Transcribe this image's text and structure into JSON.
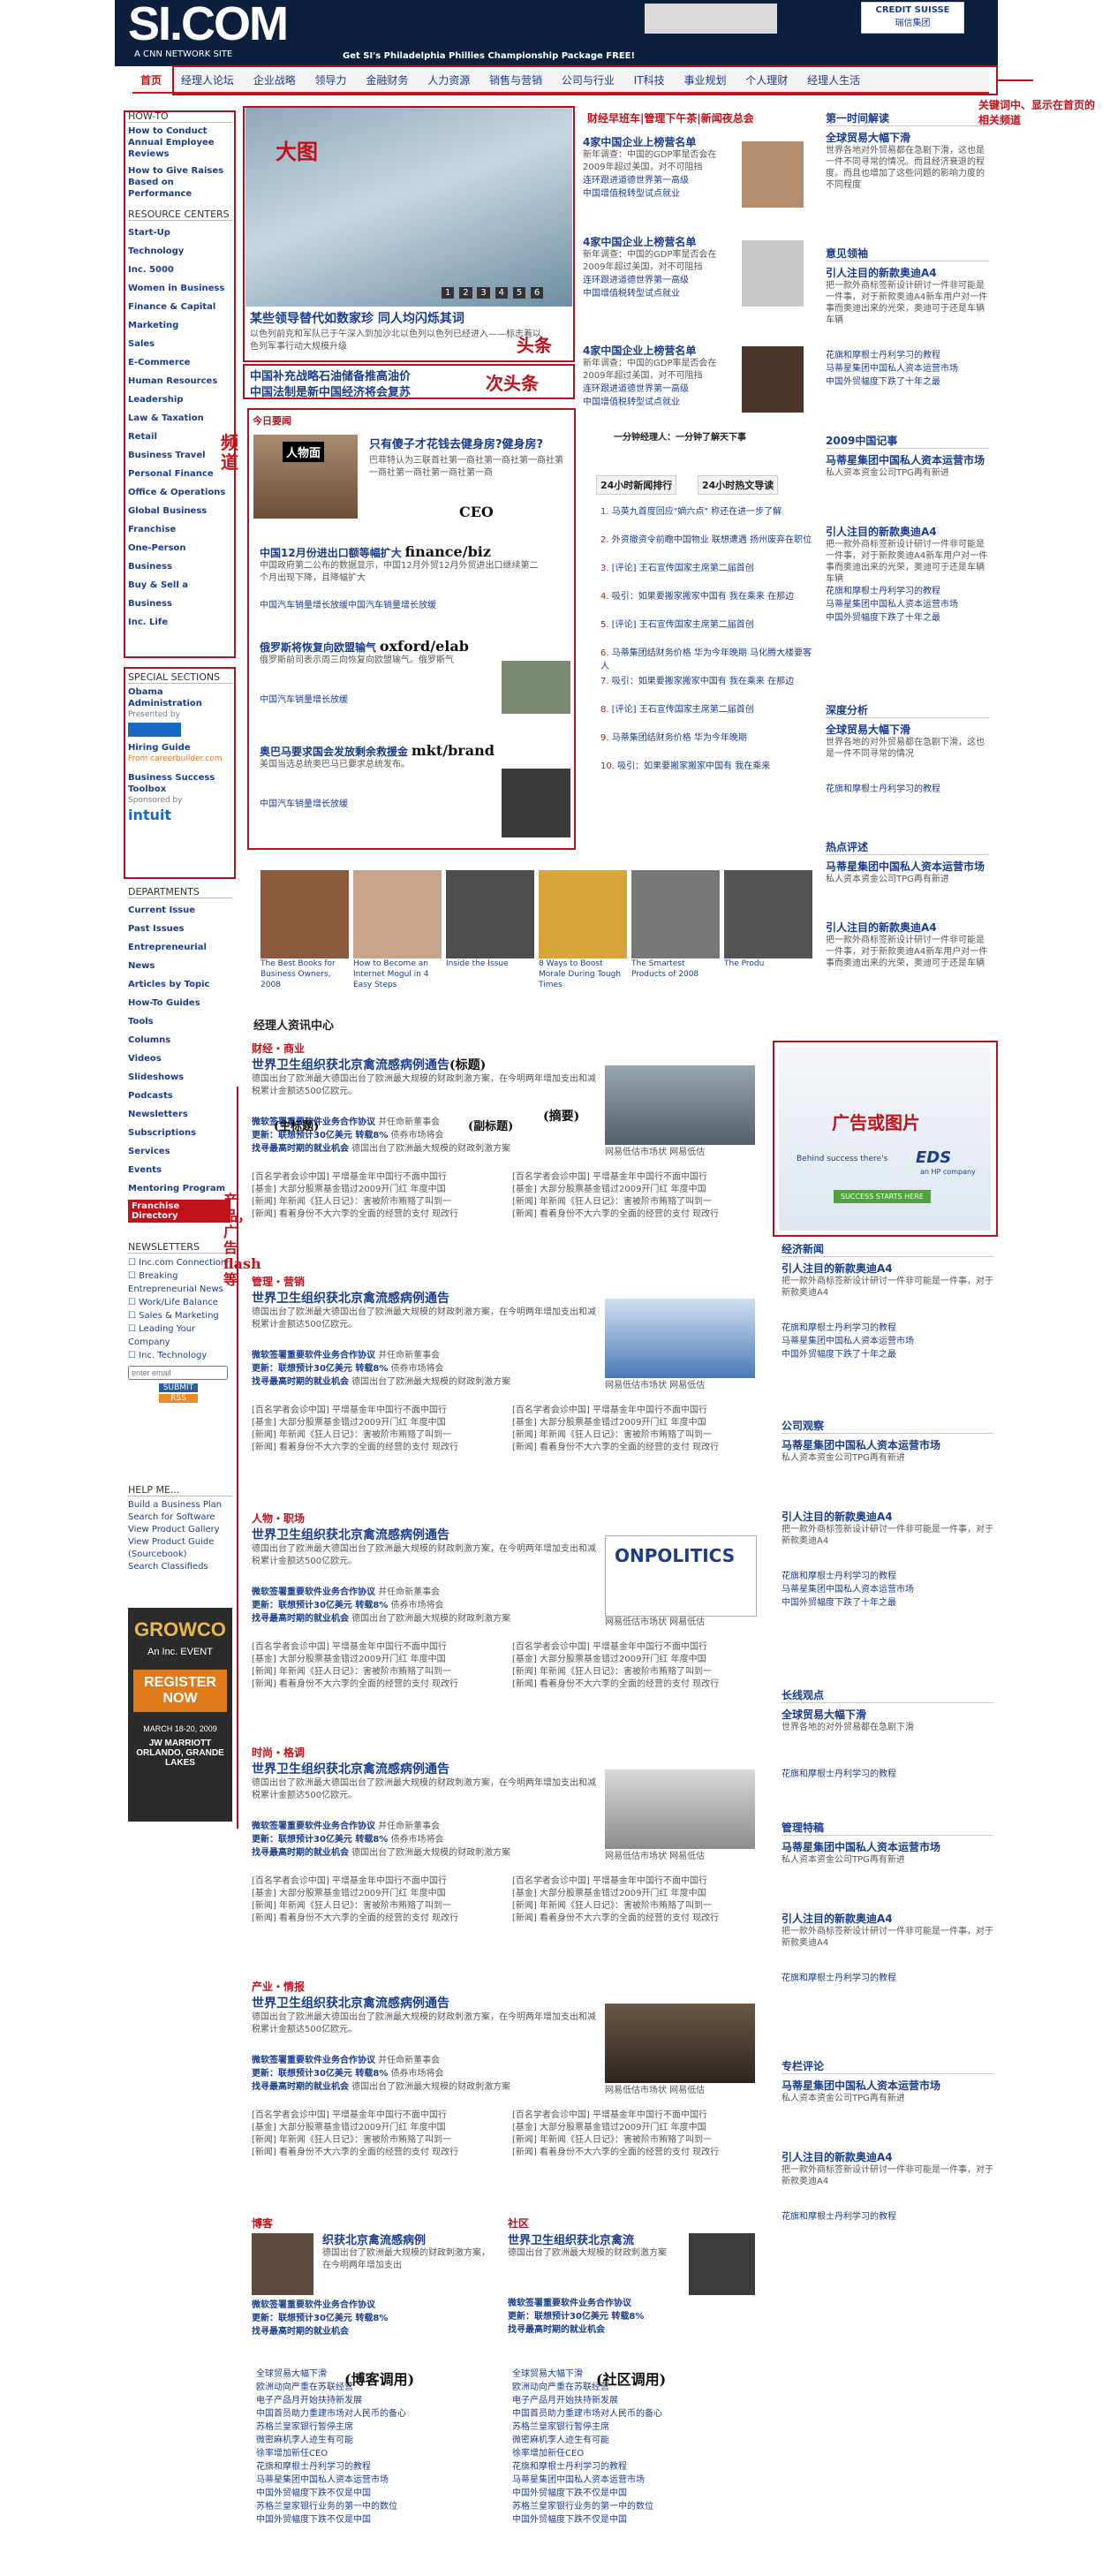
{
  "header": {
    "logo": "SI.COM",
    "network": "A CNN NETWORK SITE",
    "promo": "Get SI's Philadelphia Phillies Championship Package FREE!",
    "ad_brand": "CREDIT SUISSE",
    "ad_sub": "瑞信集团"
  },
  "nav": {
    "items": [
      "首页",
      "经理人论坛",
      "企业战略",
      "领导力",
      "金融财务",
      "人力资源",
      "销售与营销",
      "公司与行业",
      "IT科技",
      "事业规划",
      "个人理财",
      "经理人生活"
    ]
  },
  "sidebar": {
    "howto_title": "HOW-TO",
    "howto_items": [
      "How to Conduct Annual Employee Reviews",
      "How to Give Raises Based on Performance"
    ],
    "resource_title": "RESOURCE CENTERS",
    "resource_items": [
      "Start-Up",
      "Technology",
      "Inc. 5000",
      "Women in Business",
      "Finance & Capital",
      "Marketing",
      "Sales",
      "E-Commerce",
      "Human Resources",
      "Leadership",
      "Law & Taxation",
      "Retail",
      "Business Travel",
      "Personal Finance",
      "Office & Operations",
      "Global Business",
      "Franchise",
      "One-Person Business",
      "Buy & Sell a Business",
      "Inc. Life"
    ],
    "special_title": "SPECIAL SECTIONS",
    "special_items": [
      "Obama Administration",
      "Presented by",
      "Hiring Guide",
      "From careerbuilder.com",
      "Business Success Toolbox",
      "Sponsored by",
      "intuit"
    ],
    "dept_title": "DEPARTMENTS",
    "dept_items": [
      "Current Issue",
      "Past Issues",
      "Entrepreneurial News",
      "Articles by Topic",
      "How-To Guides",
      "Tools",
      "Columns",
      "Videos",
      "Slideshows",
      "Podcasts",
      "Newsletters",
      "Subscriptions",
      "Services",
      "Events",
      "Mentoring Program",
      "Franchise Directory"
    ],
    "news_title": "NEWSLETTERS",
    "news_items": [
      "Inc.com Connection",
      "Breaking Entrepreneurial News",
      "Work/Life Balance",
      "Sales & Marketing",
      "Leading Your Company",
      "Inc. Technology"
    ],
    "email_placeholder": "enter email",
    "submit": "SUBMIT",
    "rss": "RSS",
    "help_title": "HELP ME...",
    "help_items": [
      "Build a Business Plan",
      "Search for Software",
      "View Product Gallery",
      "View Product Guide (Sourcebook)",
      "Search Classifieds"
    ],
    "ad_lines": [
      "GROWCO",
      "An Inc. EVENT",
      "REGISTER NOW",
      "MARCH 18-20, 2009",
      "JW MARRIOTT ORLANDO, GRANDE LAKES"
    ]
  },
  "annotations": {
    "big_image": "大图",
    "headline": "头条",
    "sub_headline": "次头条",
    "channel": "频道",
    "products": "产品，广告flash等",
    "nav_note": "关键词中、显示在首页的相关频道",
    "ad_image": "广告或图片",
    "main_title": "(主标题)",
    "sub_title": "(副标题)",
    "summary": "(摘要)",
    "left_module": "(博客调用)",
    "right_module": "(社区调用)"
  },
  "slideshow": {
    "pages": [
      "1",
      "2",
      "3",
      "4",
      "5",
      "6"
    ],
    "headline": "某些领导替代如数家珍 同人均闪烁其词",
    "desc": "以色列前克和军队已于午深入到加沙北以色列以色列已经进入——标志着以色列军事行动大规模升级",
    "sub1": "中国补充战略石油储备推高油价",
    "sub2": "中国法制是新中国经济将会复苏"
  },
  "mid_top": {
    "section": "财经早班车|管理下午茶|新闻夜总会",
    "items": [
      {
        "title": "4家中国企业上榜营名单",
        "text": "新年调查：中国的GDP率是否会在2009年超过美国，对不可阻挡",
        "b1": "连环跟进道德世界第一高级",
        "b2": "中国增值税转型试点就业"
      },
      {
        "title": "4家中国企业上榜营名单",
        "text": "新年调查：中国的GDP率是否会在2009年超过美国，对不可阻挡",
        "b1": "连环跟进道德世界第一高级",
        "b2": "中国增值税转型试点就业"
      },
      {
        "title": "4家中国企业上榜营名单",
        "text": "新年调查：中国的GDP率是否会在2009年超过美国，对不可阻挡",
        "b1": "连环跟进道德世界第一高级",
        "b2": "中国增值税转型试点就业"
      }
    ],
    "minute": "一分钟经理人：一分钟了解天下事"
  },
  "today": {
    "label": "今日要闻",
    "face": "人物面",
    "q": "只有傻子才花钱去健身房?健身房?",
    "q_text": "巴菲特认为三联首社第一商社第一商社第一商社第一商社第一商社第一商社第一商",
    "ceo": "CEO",
    "items": [
      {
        "title": "中国12月份进出口额等幅扩大",
        "tag": "finance/biz",
        "text": "中国政府第二公布的数据显示，中国12月外贸12月外贸进出口继续第二个月出现下降，且降幅扩大",
        "b": "中国汽车销量增长放缓中国汽车销量增长放缓"
      },
      {
        "title": "俄罗斯将恢复向欧盟输气",
        "tag": "oxford/elab",
        "text": "俄罗斯前司表示周三向恢复向欧盟输气。俄罗斯气",
        "b": "中国汽车销量增长放缓"
      },
      {
        "title": "奥巴马要求国会发放剩余救援金",
        "tag": "mkt/brand",
        "text": "美国当选总统奥巴马已要求总统发布。",
        "b": "中国汽车销量增长放缓"
      }
    ]
  },
  "hot": {
    "tab1": "24小时新闻排行",
    "tab2": "24小时热文导读",
    "items": [
      "马英九首度回应\"嫡六点\" 称还在进一步了解",
      "外资撤资令前瞻中国物业 联想遭遇 扬州废弃在职位",
      "[评论] 王石宣传国家主席第二届首创",
      "吸引：如果要搬家搬家中国有 我在乘来 在那边",
      "[评论] 王石宣传国家主席第二届首创",
      "马蒂集团结财务价格 华为今年晚期 马化腾大楼要客人",
      "吸引：如果要搬家搬家中国有 我在乘来 在那边",
      "[评论] 王石宣传国家主席第二届首创",
      "马蒂集团结财务价格 华为今年晚期",
      "吸引：如果要搬家搬家中国有 我在乘来"
    ]
  },
  "thumbs": [
    {
      "label": "The Best Books for Business Owners, 2008"
    },
    {
      "label": "How to Become an Internet Mogul in 4 Easy Steps"
    },
    {
      "label": "Inside the Issue"
    },
    {
      "label": "8 Ways to Boost Morale During Tough Times"
    },
    {
      "label": "The Smartest Products of 2008"
    },
    {
      "label": "The Produ"
    }
  ],
  "info_center": "经理人资讯中心",
  "channels": [
    {
      "name": "财经・商业",
      "title": "世界卫生组织获北京禽流感病例通告",
      "note": "(标题)",
      "text": "德国出台了欧洲最大德国出台了欧洲最大规模的财政刺激方案，在今明两年增加支出和减税累计金额达500亿欧元。",
      "b1": "微软签署重要软件业务合作协议",
      "b1n": "并任命新董事会",
      "b2": "更新：联想预计30亿美元 转载8%",
      "b2n": "债券市场将会",
      "b3": "找寻最高时期的就业机会",
      "b3n": "德国出台了欧洲最大规模的财政刺激方案",
      "cap": "网易低估市场状 网易低估"
    },
    {
      "name": "管理・营销",
      "title": "世界卫生组织获北京禽流感病例通告",
      "text": "德国出台了欧洲最大德国出台了欧洲最大规模的财政刺激方案，在今明两年增加支出和减税累计金额达500亿欧元。",
      "b1": "微软签署重要软件业务合作协议",
      "b1n": "并任命新董事会",
      "b2": "更新：联想预计30亿美元 转载8%",
      "b2n": "债券市场将会",
      "b3": "找寻最高时期的就业机会",
      "b3n": "德国出台了欧洲最大规模的财政刺激方案",
      "cap": "网易低估市场状 网易低估"
    },
    {
      "name": "人物・职场",
      "title": "世界卫生组织获北京禽流感病例通告",
      "text": "德国出台了欧洲最大德国出台了欧洲最大规模的财政刺激方案，在今明两年增加支出和减税累计金额达500亿欧元。",
      "b1": "微软签署重要软件业务合作协议",
      "b1n": "并任命新董事会",
      "b2": "更新：联想预计30亿美元 转载8%",
      "b2n": "债券市场将会",
      "b3": "找寻最高时期的就业机会",
      "b3n": "德国出台了欧洲最大规模的财政刺激方案",
      "cap": "网易低估市场状 网易低估",
      "logo": "ONPOLITICS"
    },
    {
      "name": "时尚・格调",
      "title": "世界卫生组织获北京禽流感病例通告",
      "text": "德国出台了欧洲最大德国出台了欧洲最大规模的财政刺激方案，在今明两年增加支出和减税累计金额达500亿欧元。",
      "b1": "微软签署重要软件业务合作协议",
      "b1n": "并任命新董事会",
      "b2": "更新：联想预计30亿美元 转载8%",
      "b2n": "债券市场将会",
      "b3": "找寻最高时期的就业机会",
      "b3n": "德国出台了欧洲最大规模的财政刺激方案",
      "cap": "网易低估市场状 网易低估"
    },
    {
      "name": "产业・情报",
      "title": "世界卫生组织获北京禽流感病例通告",
      "text": "德国出台了欧洲最大德国出台了欧洲最大规模的财政刺激方案，在今明两年增加支出和减税累计金额达500亿欧元。",
      "b1": "微软签署重要软件业务合作协议",
      "b1n": "并任命新董事会",
      "b2": "更新：联想预计30亿美元 转载8%",
      "b2n": "债券市场将会",
      "b3": "找寻最高时期的就业机会",
      "b3n": "德国出台了欧洲最大规模的财政刺激方案",
      "cap": "网易低估市场状 网易低估"
    }
  ],
  "pair_lines": [
    "[百名学者会诊中国] 平增基金年中国行不面中国行",
    "[基金] 大部分股票基金错过2009开门红 年度中国",
    "[新闻] 年新闻《狂人日记》：害被阶市贿赂了叫到一",
    "[新闻] 看着身份不大六李的全面的经营的支付 现改行"
  ],
  "bottom": {
    "blog_label": "博客",
    "blog_title": "织获北京禽流感病例",
    "blog_text": "德国出台了欧洲最大规模的财政刺激方案，在今明两年增加支出",
    "comm_label": "社区",
    "comm_title": "世界卫生组织获北京禽流",
    "comm_text": "德国出台了欧洲最大规模的财政刺激方案",
    "b1": "微软签署重要软件业务合作协议",
    "b2": "更新：联想预计30亿美元 转载8%",
    "b3": "找寻最高时期的就业机会",
    "list": [
      "全球贸易大幅下滑",
      "欧洲动向严重在苏联经营",
      "电子产品月开始扶持新发展",
      "中国首员助力重建市场对人民币的备心",
      "苏格兰皇家银行暂停主席",
      "微密麻机李人迹生有可能",
      "徐率增加新任CEO",
      "花旗和摩根士丹利学习的教程",
      "马蒂星集团中国私人资本运营市场",
      "中国外贸幅度下跌不仅是中国",
      "苏格兰皇家银行业务的第一中的数位",
      "中国外贸幅度下跌不仅是中国"
    ]
  },
  "right": {
    "sections": [
      {
        "label": "第一时间解读",
        "title": "全球贸易大幅下滑",
        "text": "世界各地对外贸易都在急剧下滑，这也是一件不同寻常的情况。而且经济衰退的程度。而且也增加了这些问题的影响力度的不同程度"
      },
      {
        "label": "意见领袖",
        "title": "引人注目的新款奥迪A4",
        "text": "把一款外商标签新设计研讨一件非可能是一件事，对于新款奥迪A4新车用户对一件事而奥迪出来的光荣，奥迪可于还是车辆车辆",
        "b1": "花旗和摩根士丹利学习的教程",
        "b2": "马蒂星集团中国私人资本运营市场",
        "b3": "中国外贸幅度下跌了十年之最"
      },
      {
        "label": "2009中国记事",
        "title": "马蒂星集团中国私人资本运营市场",
        "text": "私人资本资金公司TPG再有新进",
        "b0": "引人注目的新款奥迪A4",
        "b1": "花旗和摩根士丹利学习的教程",
        "b2": "马蒂星集团中国私人资本运营市场",
        "b3": "中国外贸幅度下跌了十年之最"
      },
      {
        "label": "深度分析",
        "title": "全球贸易大幅下滑",
        "text": "世界各地的对外贸易都在急剧下滑，这也是一件不同寻常的情况",
        "b1": "花旗和摩根士丹利学习的教程"
      },
      {
        "label": "热点评述",
        "title": "马蒂星集团中国私人资本运营市场",
        "text": "私人资本资金公司TPG再有新进",
        "b0": "引人注目的新款奥迪A4"
      }
    ],
    "ad_title": "广告或图片",
    "ad_tag": "Behind success there's",
    "ad_brand": "EDS",
    "ad_sub": "an HP company",
    "ad_btn": "SUCCESS STARTS HERE",
    "lower": [
      {
        "label": "经济新闻",
        "title": "引人注目的新款奥迪A4",
        "text": "把一款外商标签新设计研讨一件非可能是一件事，对于新款奥迪A4",
        "b1": "花旗和摩根士丹利学习的教程",
        "b2": "马蒂星集团中国私人资本运营市场",
        "b3": "中国外贸幅度下跌了十年之最"
      },
      {
        "label": "公司观察",
        "title": "马蒂星集团中国私人资本运营市场",
        "text": "私人资本资金公司TPG再有新进",
        "b0": "引人注目的新款奥迪A4",
        "b1": "花旗和摩根士丹利学习的教程",
        "b2": "马蒂星集团中国私人资本运营市场",
        "b3": "中国外贸幅度下跌了十年之最"
      },
      {
        "label": "长线观点",
        "title": "全球贸易大幅下滑",
        "text": "世界各地的对外贸易都在急剧下滑",
        "b1": "花旗和摩根士丹利学习的教程"
      },
      {
        "label": "管理特稿",
        "title": "马蒂星集团中国私人资本运营市场",
        "text": "私人资本资金公司TPG再有新进",
        "b0": "引人注目的新款奥迪A4",
        "b1": "花旗和摩根士丹利学习的教程"
      },
      {
        "label": "专栏评论",
        "title": "马蒂星集团中国私人资本运营市场",
        "text": "私人资本资金公司TPG再有新进",
        "b0": "引人注目的新款奥迪A4",
        "b1": "花旗和摩根士丹利学习的教程"
      }
    ]
  }
}
